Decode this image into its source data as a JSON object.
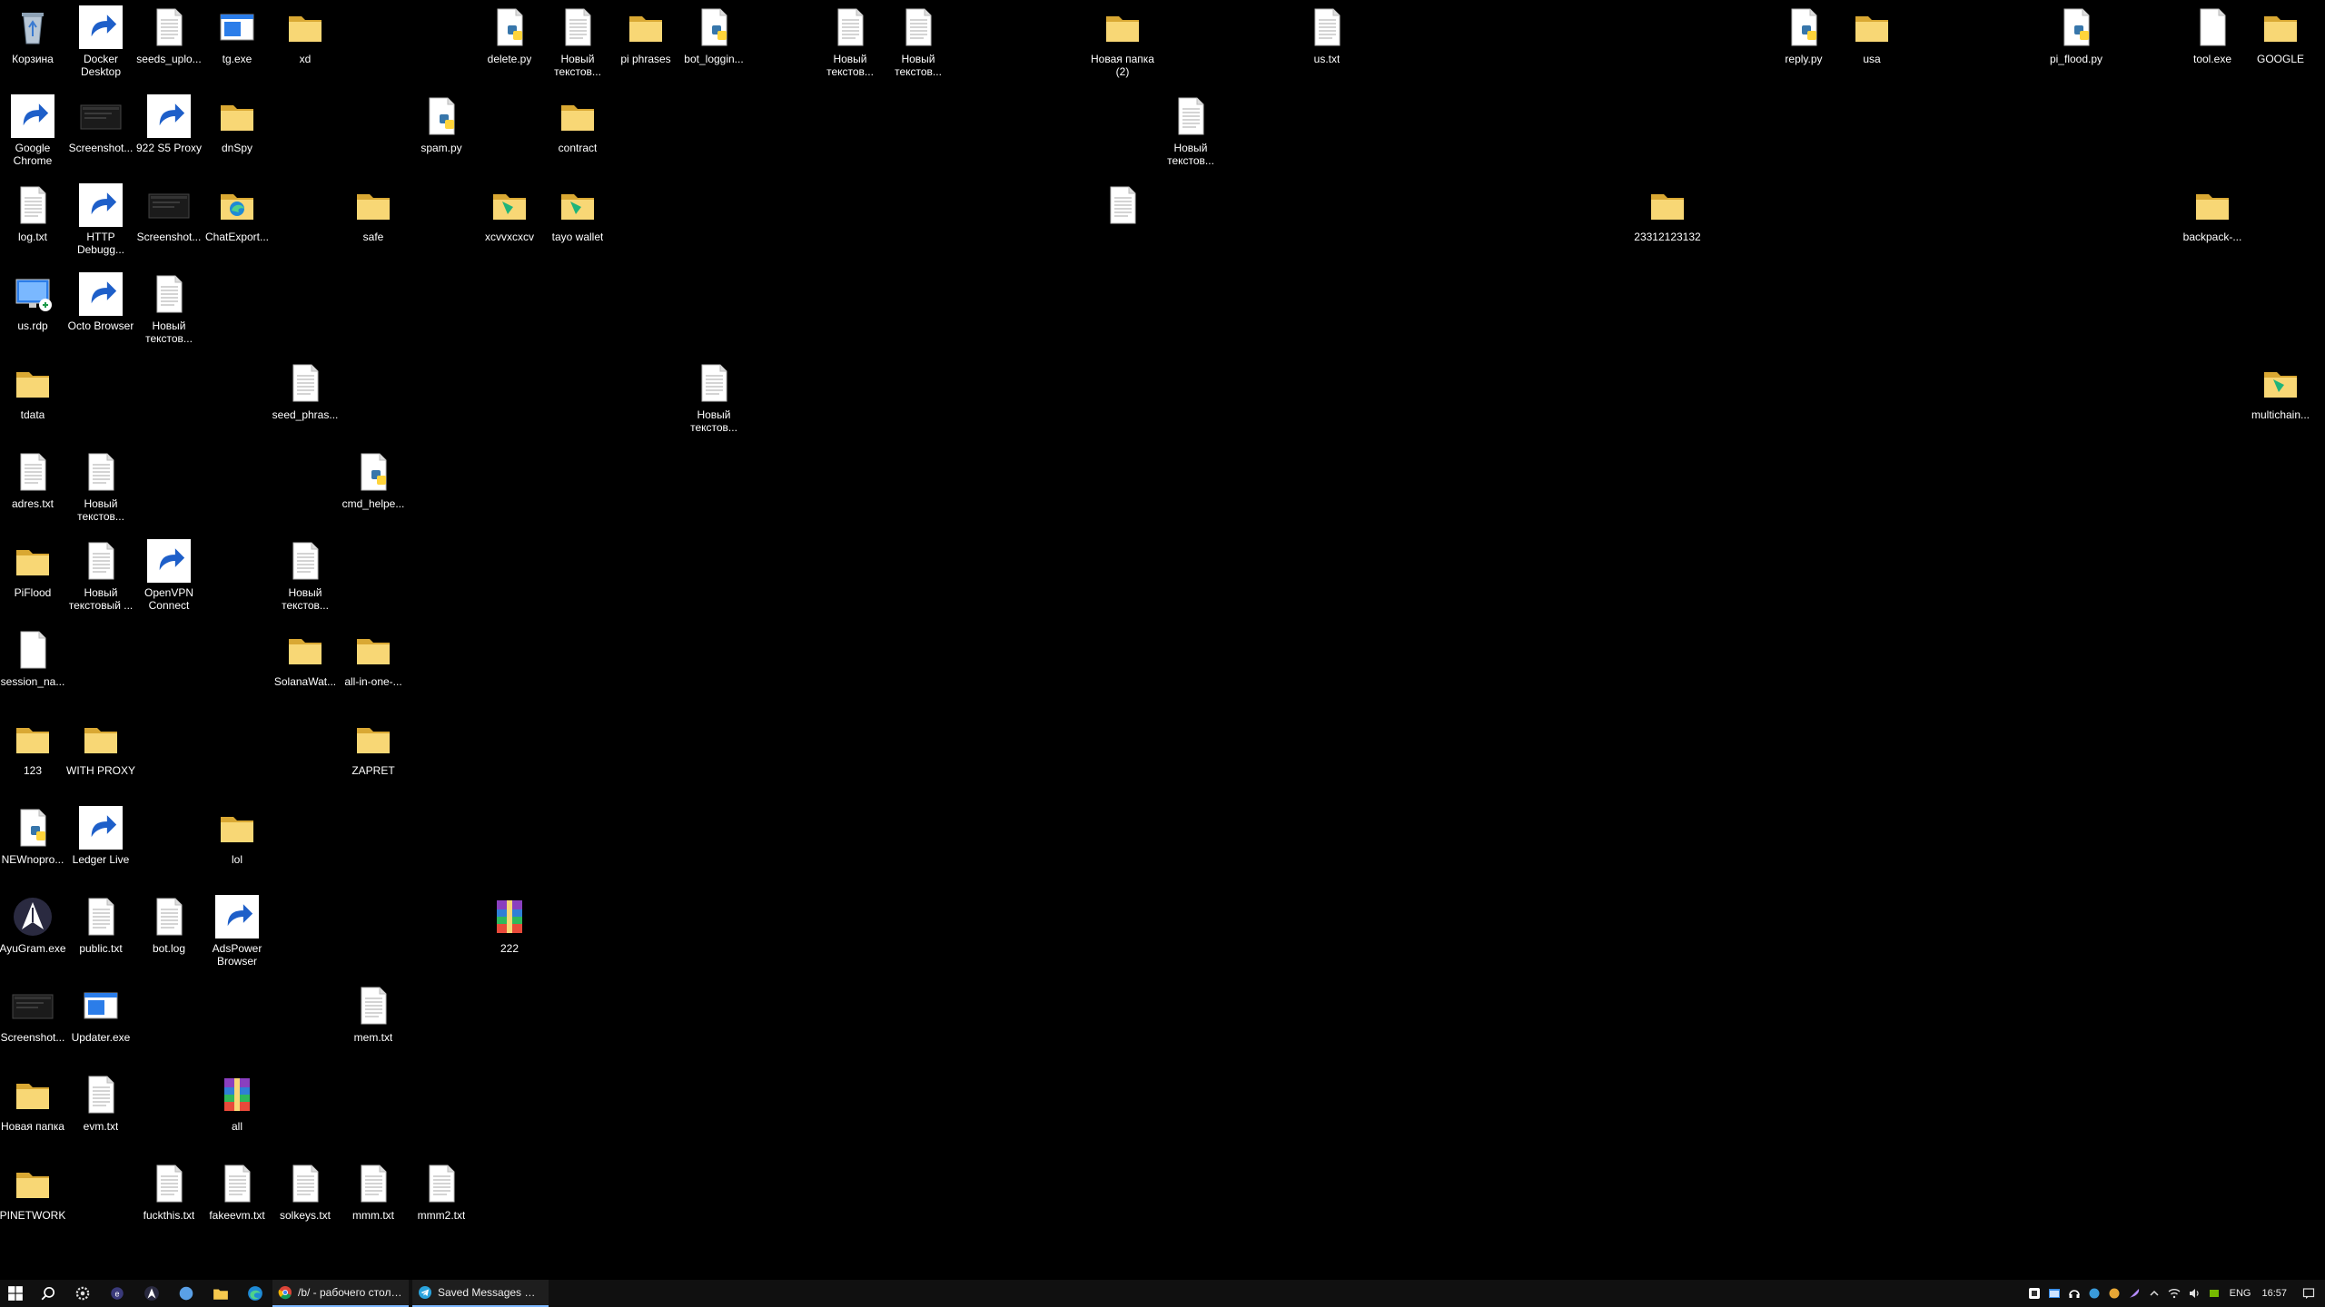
{
  "desktop": {
    "icons": [
      {
        "label": "Корзина",
        "type": "recycle"
      },
      {
        "label": "Docker Desktop",
        "type": "docker"
      },
      {
        "label": "seeds_uplo...",
        "type": "txt"
      },
      {
        "label": "tg.exe",
        "type": "exe"
      },
      {
        "label": "xd",
        "type": "folder"
      },
      {
        "label": "delete.py",
        "type": "py"
      },
      {
        "label": "Новый текстов...",
        "type": "txt"
      },
      {
        "label": "pi phrases",
        "type": "folder"
      },
      {
        "label": "bot_loggin...",
        "type": "py"
      },
      {
        "label": "Новый текстов...",
        "type": "txt"
      },
      {
        "label": "Новый текстов...",
        "type": "txt"
      },
      {
        "label": "Новая папка (2)",
        "type": "folder"
      },
      {
        "label": "us.txt",
        "type": "txt"
      },
      {
        "label": "reply.py",
        "type": "py"
      },
      {
        "label": "usa",
        "type": "folder"
      },
      {
        "label": "pi_flood.py",
        "type": "py"
      },
      {
        "label": "tool.exe",
        "type": "blank"
      },
      {
        "label": "GOOGLE",
        "type": "folder"
      },
      {
        "label": "Google Chrome",
        "type": "chrome"
      },
      {
        "label": "Screenshot...",
        "type": "shot"
      },
      {
        "label": "922 S5 Proxy",
        "type": "proxy"
      },
      {
        "label": "dnSpy",
        "type": "folder"
      },
      {
        "label": "spam.py",
        "type": "py"
      },
      {
        "label": "contract",
        "type": "folder"
      },
      {
        "label": "Новый текстов...",
        "type": "txt"
      },
      {
        "label": "log.txt",
        "type": "txt"
      },
      {
        "label": "HTTP Debugg...",
        "type": "http"
      },
      {
        "label": "Screenshot...",
        "type": "shot"
      },
      {
        "label": "ChatExport...",
        "type": "edgefolder"
      },
      {
        "label": "safe",
        "type": "folder"
      },
      {
        "label": "xcvvxcxcv",
        "type": "greenfolder"
      },
      {
        "label": "tayo wallet",
        "type": "greenfolder"
      },
      {
        "label": "",
        "type": "txt"
      },
      {
        "label": "23312123132",
        "type": "folder"
      },
      {
        "label": "backpack-...",
        "type": "folder"
      },
      {
        "label": "us.rdp",
        "type": "rdp"
      },
      {
        "label": "Octo Browser",
        "type": "octo"
      },
      {
        "label": "Новый текстов...",
        "type": "txt"
      },
      {
        "label": "tdata",
        "type": "folder"
      },
      {
        "label": "seed_phras...",
        "type": "txt"
      },
      {
        "label": "Новый текстов...",
        "type": "txt"
      },
      {
        "label": "multichain...",
        "type": "greenfolder"
      },
      {
        "label": "adres.txt",
        "type": "txt"
      },
      {
        "label": "Новый текстов...",
        "type": "txt"
      },
      {
        "label": "cmd_helpe...",
        "type": "py"
      },
      {
        "label": "PiFlood",
        "type": "folder"
      },
      {
        "label": "Новый текстовый ...",
        "type": "txt"
      },
      {
        "label": "OpenVPN Connect",
        "type": "openvpn"
      },
      {
        "label": "Новый текстов...",
        "type": "txt"
      },
      {
        "label": "session_na...",
        "type": "blank"
      },
      {
        "label": "SolanaWat...",
        "type": "folder"
      },
      {
        "label": "all-in-one-...",
        "type": "folder"
      },
      {
        "label": "123",
        "type": "folder"
      },
      {
        "label": "WITH PROXY",
        "type": "folder"
      },
      {
        "label": "ZAPRET",
        "type": "folder"
      },
      {
        "label": "NEWnopro...",
        "type": "py"
      },
      {
        "label": "Ledger Live",
        "type": "ledger"
      },
      {
        "label": "lol",
        "type": "folder"
      },
      {
        "label": "AyuGram.exe",
        "type": "ayugram"
      },
      {
        "label": "public.txt",
        "type": "txt"
      },
      {
        "label": "bot.log",
        "type": "txt"
      },
      {
        "label": "AdsPower Browser",
        "type": "adspower"
      },
      {
        "label": "222",
        "type": "rar"
      },
      {
        "label": "Screenshot...",
        "type": "shot"
      },
      {
        "label": "Updater.exe",
        "type": "exe"
      },
      {
        "label": "mem.txt",
        "type": "txt"
      },
      {
        "label": "Новая папка",
        "type": "folder"
      },
      {
        "label": "evm.txt",
        "type": "txt"
      },
      {
        "label": "all",
        "type": "rar"
      },
      {
        "label": "PINETWORK",
        "type": "folder"
      },
      {
        "label": "fuckthis.txt",
        "type": "txt"
      },
      {
        "label": "fakeevm.txt",
        "type": "txt"
      },
      {
        "label": "solkeys.txt",
        "type": "txt"
      },
      {
        "label": "mmm.txt",
        "type": "txt"
      },
      {
        "label": "mmm2.txt",
        "type": "txt"
      }
    ]
  },
  "taskbar": {
    "apps": [
      {
        "label": "/b/ - рабочего стола...",
        "icon": "chrome"
      },
      {
        "label": "Saved Messages @ h...",
        "icon": "telegram"
      }
    ],
    "language": "ENG",
    "clock": "16:57"
  }
}
